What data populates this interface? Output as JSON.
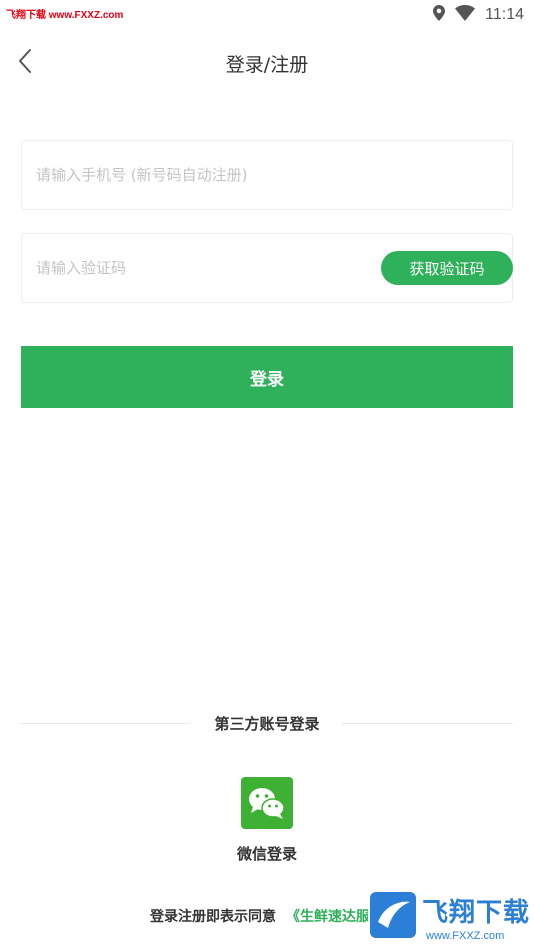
{
  "status_bar": {
    "watermark": "飞翔下载 www.FXXZ.com",
    "time": "11:14"
  },
  "header": {
    "title": "登录/注册"
  },
  "form": {
    "phone_placeholder": "请输入手机号 (新号码自动注册)",
    "code_placeholder": "请输入验证码",
    "get_code_label": "获取验证码",
    "login_label": "登录"
  },
  "third_party": {
    "title": "第三方账号登录",
    "wechat_label": "微信登录"
  },
  "agreement": {
    "text": "登录注册即表示同意",
    "link": "《生鲜速达服务"
  },
  "watermark_bottom": {
    "brand": "飞翔下载",
    "url": "www.FXXZ.com"
  },
  "colors": {
    "accent": "#2fb05a",
    "wechat": "#3eb135",
    "watermark_blue": "#2b7fd6"
  },
  "icons": [
    "location-icon",
    "wifi-icon",
    "back-arrow-icon",
    "wechat-icon"
  ]
}
